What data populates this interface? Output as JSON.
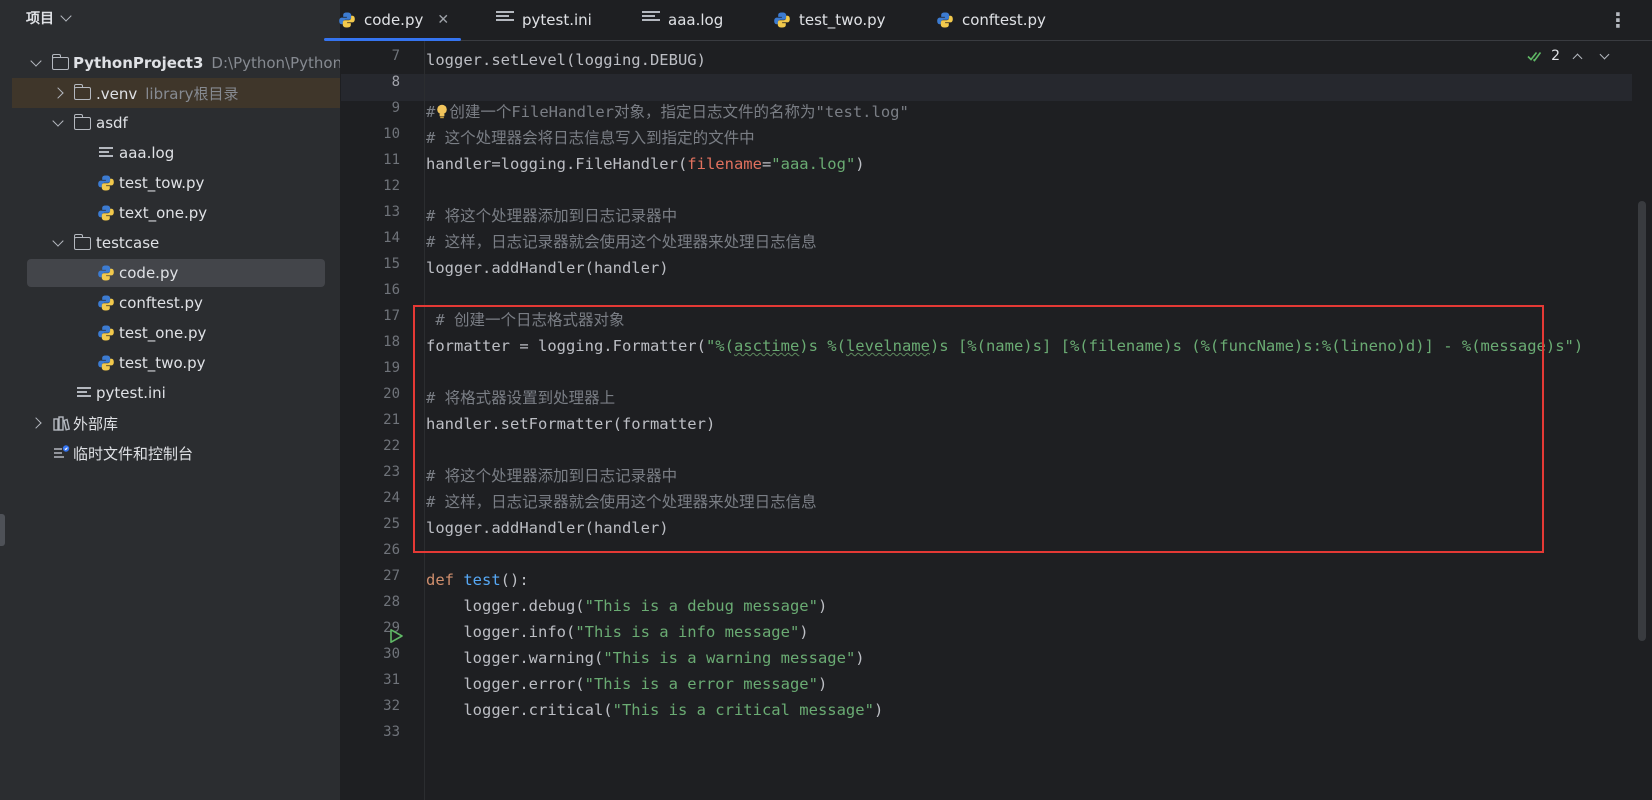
{
  "project_panel": {
    "title": "项目",
    "tree": [
      {
        "label": "PythonProject3",
        "hint": "D:\\Python\\PythonP",
        "icon": "folder-icon"
      },
      {
        "label": ".venv",
        "hint": "library根目录",
        "icon": "folder-icon"
      },
      {
        "label": "asdf",
        "icon": "folder-icon"
      },
      {
        "label": "aaa.log",
        "icon": "text-file-icon"
      },
      {
        "label": "test_tow.py",
        "icon": "python-file-icon"
      },
      {
        "label": "text_one.py",
        "icon": "python-file-icon"
      },
      {
        "label": "testcase",
        "icon": "folder-icon"
      },
      {
        "label": "code.py",
        "icon": "python-file-icon"
      },
      {
        "label": "conftest.py",
        "icon": "python-file-icon"
      },
      {
        "label": "test_one.py",
        "icon": "python-file-icon"
      },
      {
        "label": "test_two.py",
        "icon": "python-file-icon"
      },
      {
        "label": "pytest.ini",
        "icon": "text-file-icon"
      },
      {
        "label": "外部库",
        "icon": "library-icon"
      },
      {
        "label": "临时文件和控制台",
        "icon": "scratch-icon"
      }
    ]
  },
  "tabs": [
    {
      "label": "code.py",
      "icon": "python-file-icon",
      "active": true
    },
    {
      "label": "pytest.ini",
      "icon": "text-file-icon"
    },
    {
      "label": "aaa.log",
      "icon": "text-file-icon"
    },
    {
      "label": "test_two.py",
      "icon": "python-file-icon"
    },
    {
      "label": "conftest.py",
      "icon": "python-file-icon"
    }
  ],
  "inspection": {
    "count": "2"
  },
  "editor": {
    "current_line": 8,
    "lines": [
      {
        "n": "7"
      },
      {
        "n": "8"
      },
      {
        "n": "9"
      },
      {
        "n": "10"
      },
      {
        "n": "11"
      },
      {
        "n": "12"
      },
      {
        "n": "13"
      },
      {
        "n": "14"
      },
      {
        "n": "15"
      },
      {
        "n": "16"
      },
      {
        "n": "17"
      },
      {
        "n": "18"
      },
      {
        "n": "19"
      },
      {
        "n": "20"
      },
      {
        "n": "21"
      },
      {
        "n": "22"
      },
      {
        "n": "23"
      },
      {
        "n": "24"
      },
      {
        "n": "25"
      },
      {
        "n": "26"
      },
      {
        "n": "27"
      },
      {
        "n": "28"
      },
      {
        "n": "29"
      },
      {
        "n": "30"
      },
      {
        "n": "31"
      },
      {
        "n": "32"
      },
      {
        "n": "33"
      }
    ],
    "code": {
      "l7": "logger.setLevel(logging.DEBUG)",
      "l9a": "#",
      "l9b": "创建一个FileHandler对象，指定日志文件的名称为\"test.log\"",
      "l10": "# 这个处理器会将日志信息写入到指定的文件中",
      "l11a": "handler=logging.FileHandler(",
      "l11b": "filename",
      "l11c": "=",
      "l11d": "\"aaa.log\"",
      "l11e": ")",
      "l13": "# 将这个处理器添加到日志记录器中",
      "l14": "# 这样，日志记录器就会使用这个处理器来处理日志信息",
      "l15": "logger.addHandler(handler)",
      "l17": " # 创建一个日志格式器对象",
      "l18a": "formatter = logging.Formatter(",
      "l18b": "\"%(",
      "l18c": "asctime",
      "l18d": ")s %(",
      "l18e": "levelname",
      "l18f": ")s [%(name)s] [%(filename)s (%(funcName)s:%(lineno)d)] - %(message)s\")",
      "l20": "# 将格式器设置到处理器上",
      "l21": "handler.setFormatter(formatter)",
      "l23": "# 将这个处理器添加到日志记录器中",
      "l24": "# 这样，日志记录器就会使用这个处理器来处理日志信息",
      "l25": "logger.addHandler(handler)",
      "l27a": "def ",
      "l27b": "test",
      "l27c": "():",
      "l28a": "    logger.debug(",
      "l28b": "\"This is a debug message\"",
      "l28c": ")",
      "l29a": "    logger.info(",
      "l29b": "\"This is a info message\"",
      "l29c": ")",
      "l30a": "    logger.warning(",
      "l30b": "\"This is a warning message\"",
      "l30c": ")",
      "l31a": "    logger.error(",
      "l31b": "\"This is a error message\"",
      "l31c": ")",
      "l32a": "    logger.critical(",
      "l32b": "\"This is a critical message\"",
      "l32c": ")"
    }
  },
  "colors": {
    "comment": "#7a7e85",
    "string": "#6aab73",
    "keyword": "#cf8e6d",
    "function": "#56a8f5",
    "param": "#e1715e",
    "highlight_box": "#e53935",
    "tab_accent": "#3574f0"
  }
}
